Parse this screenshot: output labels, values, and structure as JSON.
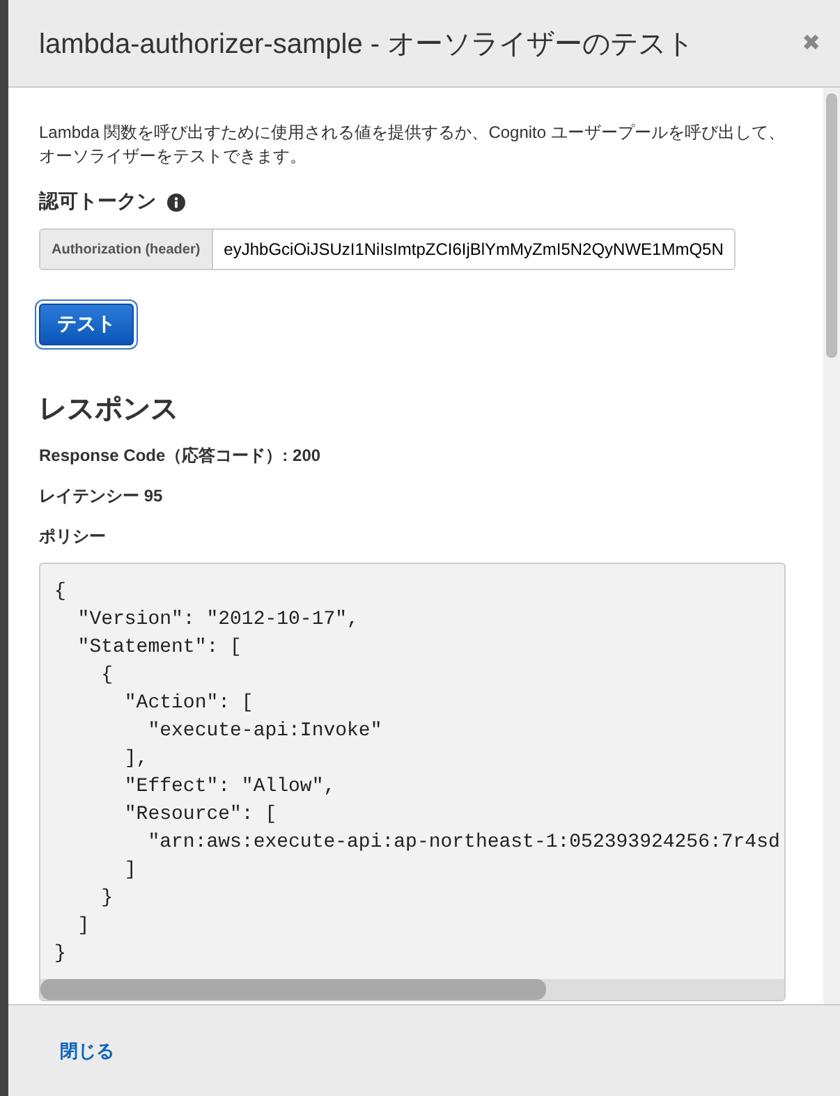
{
  "dialog": {
    "title": "lambda-authorizer-sample - オーソライザーのテスト",
    "close_icon": "✖"
  },
  "description": "Lambda 関数を呼び出すために使用される値を提供するか、Cognito ユーザープールを呼び出して、オーソライザーをテストできます。",
  "token": {
    "label": "認可トークン",
    "addon": "Authorization (header)",
    "value": "eyJhbGciOiJSUzI1NiIsImtpZCI6IjBlYmMyZmI5N2QyNWE1MmQ5N"
  },
  "test_button": "テスト",
  "response": {
    "heading": "レスポンス",
    "code": "Response Code（応答コード）: 200",
    "latency": "レイテンシー 95",
    "policy_label": "ポリシー",
    "policy_lines": [
      "{",
      "  \"Version\": \"2012-10-17\",",
      "  \"Statement\": [",
      "    {",
      "      \"Action\": [",
      "        \"execute-api:Invoke\"",
      "      ],",
      "      \"Effect\": \"Allow\",",
      "      \"Resource\": [",
      "        \"arn:aws:execute-api:ap-northeast-1:052393924256:7r4sd",
      "      ]",
      "    }",
      "  ]",
      "}"
    ]
  },
  "footer": {
    "close_link": "閉じる"
  }
}
